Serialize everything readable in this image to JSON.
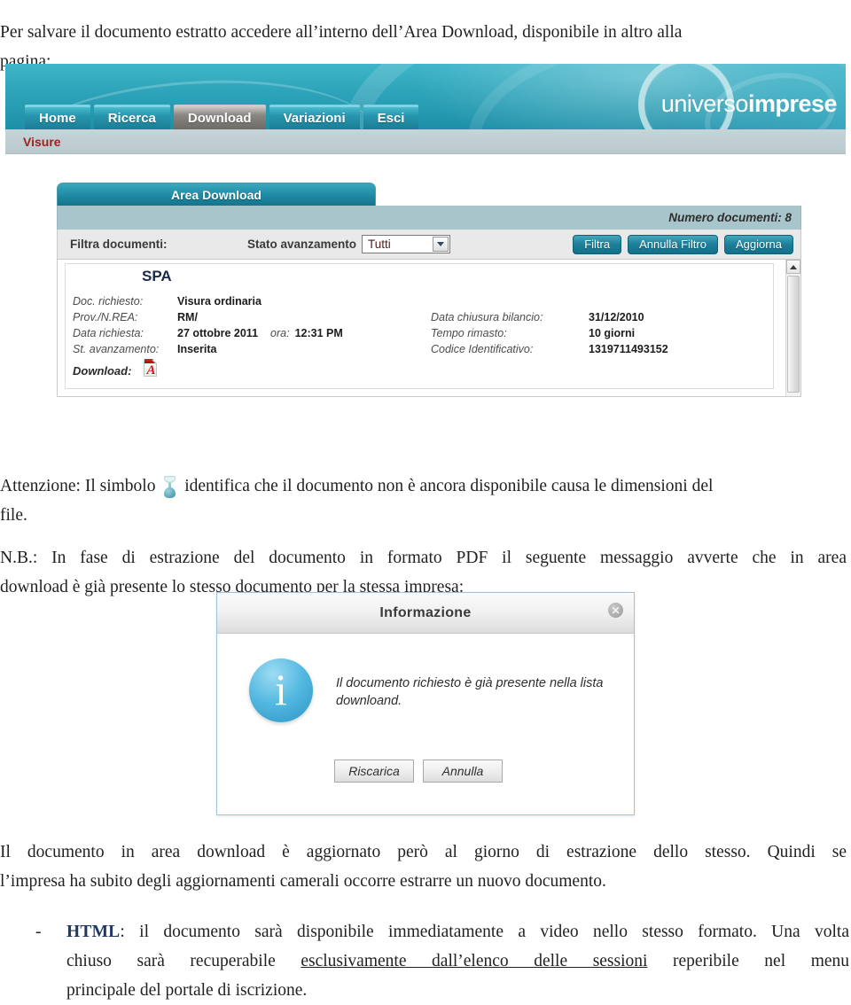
{
  "document": {
    "intro": {
      "line1": "Per salvare il documento estratto accedere all’interno dell’Area Download, disponibile in altro alla",
      "line2": "pagina:"
    },
    "attention": {
      "before_icon": "Attenzione: Il simbolo",
      "after_icon": "identifica che il documento non è ancora disponibile causa le dimensioni del",
      "line2": "file."
    },
    "note": {
      "line1": "N.B.: In fase di estrazione del documento in formato PDF il seguente messaggio avverte che in area",
      "line2": "download è già presente lo stesso documento per la stessa impresa:"
    },
    "update_note": {
      "line1": "Il documento in area download è aggiornato però al giorno di estrazione dello stesso. Quindi se",
      "line2": "l’impresa ha subito degli aggiornamenti camerali occorre estrarre un nuovo documento."
    },
    "html_bullet": {
      "marker": "-",
      "keyword": "HTML",
      "part1": ": il documento sarà disponibile immediatamente a video nello stesso formato. Una volta",
      "part2": "chiuso sarà recuperabile",
      "link": "esclusivamente dall’elenco delle sessioni",
      "part3": "reperibile nel menu",
      "part4": "principale del portale di iscrizione."
    }
  },
  "app": {
    "logo": {
      "light": "universo",
      "bold": "imprese"
    },
    "nav": [
      {
        "label": "Home",
        "active": false
      },
      {
        "label": "Ricerca",
        "active": false
      },
      {
        "label": "Download",
        "active": true
      },
      {
        "label": "Variazioni",
        "active": false
      },
      {
        "label": "Esci",
        "active": false
      }
    ],
    "breadcrumb": "Visure",
    "panel": {
      "tab_title": "Area Download",
      "document_count": "Numero documenti: 8",
      "filter_label": "Filtra documenti:",
      "state_label": "Stato avanzamento",
      "state_value": "Tutti",
      "buttons": {
        "filter": "Filtra",
        "clear_filter": "Annulla Filtro",
        "refresh": "Aggiorna"
      }
    },
    "record": {
      "title": "SPA",
      "left": [
        {
          "key": "Doc. richiesto:",
          "value": "Visura ordinaria"
        },
        {
          "key": "Prov./N.REA:",
          "value": "RM/"
        },
        {
          "key": "Data richiesta:",
          "value": "27 ottobre 2011",
          "key2": "ora:",
          "value2": "12:31 PM"
        },
        {
          "key": "St. avanzamento:",
          "value": "Inserita"
        }
      ],
      "right": [
        {
          "key": "Data chiusura bilancio:",
          "value": "31/12/2010"
        },
        {
          "key": "Tempo rimasto:",
          "value": "10 giorni"
        },
        {
          "key": "Codice Identificativo:",
          "value": "1319711493152"
        }
      ],
      "download_label": "Download:"
    }
  },
  "dialog": {
    "title": "Informazione",
    "close": "✕",
    "message": "Il documento richiesto è già presente nella lista downloand.",
    "buttons": {
      "reload": "Riscarica",
      "cancel": "Annulla"
    }
  }
}
